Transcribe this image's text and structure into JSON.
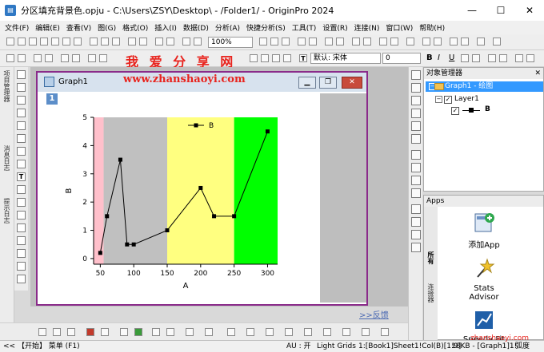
{
  "window": {
    "title": "分区填充背景色.opju - C:\\Users\\ZSY\\Desktop\\ - /Folder1/ - OriginPro 2024",
    "minimize": "—",
    "maximize": "☐",
    "close": "✕"
  },
  "menu": [
    "文件(F)",
    "编辑(E)",
    "查看(V)",
    "图(G)",
    "格式(O)",
    "插入(I)",
    "数据(D)",
    "分析(A)",
    "快捷分析(S)",
    "工具(T)",
    "设置(R)",
    "连接(N)",
    "窗口(W)",
    "帮助(H)"
  ],
  "toolbar": {
    "zoom": "100%",
    "font_name": "默认: 宋体",
    "font_size": "0",
    "bold": "B",
    "italic": "I",
    "underline": "U",
    "text_tool": "T"
  },
  "watermark": {
    "line1": "我 爱 分 享 网",
    "line2": "www.zhanshaoyi.com",
    "corner": "zhanshaoyi.com"
  },
  "left_tabs": [
    "项目管理器",
    "消息日志",
    "提示日志"
  ],
  "graph": {
    "window_title": "Graph1",
    "layer_number": "1",
    "minimize": "▁",
    "restore": "❐",
    "close": "✕"
  },
  "chart_data": {
    "type": "line",
    "x": [
      50,
      60,
      80,
      90,
      100,
      150,
      200,
      220,
      250,
      300
    ],
    "series": [
      {
        "name": "B",
        "values": [
          0.2,
          1.5,
          3.5,
          0.5,
          0.5,
          1.0,
          2.5,
          1.5,
          1.5,
          4.5
        ],
        "color": "#000000",
        "marker": "square"
      }
    ],
    "xlabel": "A",
    "ylabel": "B",
    "xlim": [
      40,
      315
    ],
    "ylim": [
      -0.2,
      5.0
    ],
    "xticks": [
      50,
      100,
      150,
      200,
      250,
      300
    ],
    "yticks": [
      0,
      1,
      2,
      3,
      4,
      5
    ],
    "legend": {
      "label": "B",
      "placement": "top-center"
    },
    "background_bands": [
      {
        "from": 40,
        "to": 55,
        "color": "#ffc0cb"
      },
      {
        "from": 55,
        "to": 150,
        "color": "#c0c0c0"
      },
      {
        "from": 150,
        "to": 250,
        "color": "#ffff80"
      },
      {
        "from": 250,
        "to": 315,
        "color": "#00ff00"
      }
    ],
    "grid": false
  },
  "object_manager": {
    "title": "对象管理器",
    "close": "✕",
    "graph_node": "Graph1 - 绘图",
    "layer_node": "Layer1",
    "series_node": "B"
  },
  "apps": {
    "title": "Apps",
    "tabs": [
      "所有",
      "连接器"
    ],
    "items": [
      {
        "label": "添加App"
      },
      {
        "label": "Stats Advisor"
      },
      {
        "label": "Speedy Fit"
      }
    ]
  },
  "feedback": ">>反馈",
  "status": {
    "start": "<<  【开始】 菜单 (F1)",
    "au": "AU : 开",
    "grids": "Light Grids",
    "sheet": "1:[Book1]Sheet1!Col(B)[1:9]",
    "size": "18KB - [Graph1]1!",
    "unit": "弧度"
  },
  "colors": {
    "graph_border": "#8a2b8a",
    "selection": "#3399ff",
    "watermark": "#e8231d"
  }
}
